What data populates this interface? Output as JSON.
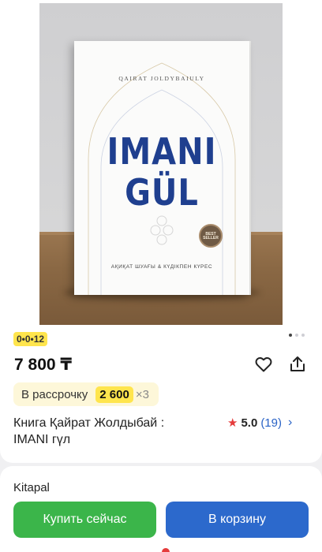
{
  "product": {
    "image": {
      "book_author": "QAIRAT JOLDYBAIULY",
      "book_title_line1": "IMANI",
      "book_title_line2": "GÜL",
      "book_subtitle": "АҚИҚАТ ШУАҒЫ & КҮДІКПЕН КҮРЕС",
      "seal_text": "BEST SELLER",
      "carousel_total": 3,
      "carousel_active": 1
    },
    "installment_badge": "0•0•12",
    "price": "7 800 ₸",
    "installment": {
      "label": "В рассрочку",
      "amount": "2 600",
      "multiplier": "×3"
    },
    "title": "Книга Қайрат Жолдыбай : IMANI гүл",
    "rating": {
      "score": "5.0",
      "count": "(19)"
    }
  },
  "seller": {
    "name": "Kitapal"
  },
  "actions": {
    "buy_now": "Купить сейчас",
    "add_to_cart": "В корзину"
  },
  "colors": {
    "accent_yellow": "#ffe54d",
    "buy_green": "#3bb54a",
    "cart_blue": "#2c69cc",
    "star_red": "#e53b3b",
    "link_blue": "#2a63c6"
  },
  "icons": {
    "favorite": "heart-icon",
    "share": "share-icon",
    "rating": "star-icon",
    "more": "chevron-right-icon"
  }
}
